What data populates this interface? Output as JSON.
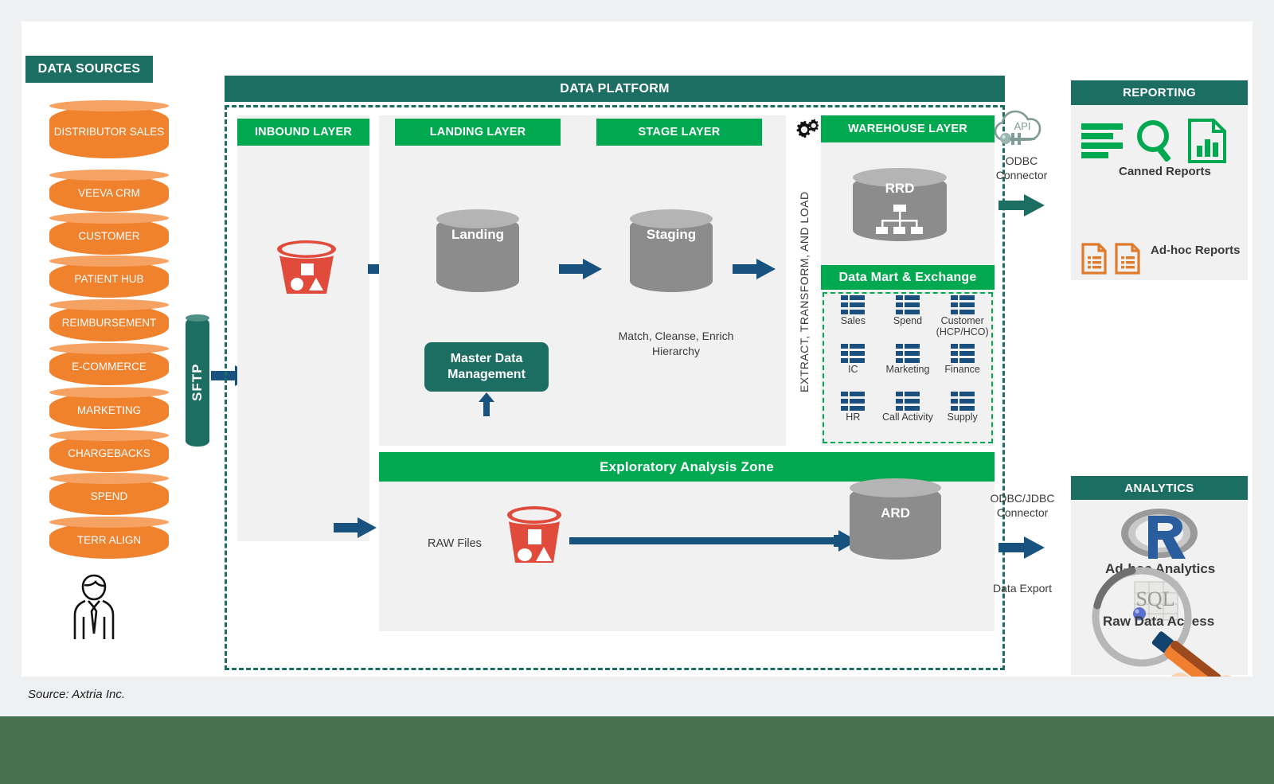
{
  "source_note": "Source: Axtria Inc.",
  "colors": {
    "teal": "#1d6e62",
    "green": "#00a84f",
    "orange": "#f0812d",
    "blue": "#18527f",
    "grey_cyl": "#8c8c8c",
    "red_bucket": "#e04b3c",
    "footer_green": "#477050",
    "panel_grey": "#f1f1f1"
  },
  "data_sources": {
    "header": "DATA SOURCES",
    "items": [
      "DISTRIBUTOR SALES",
      "VEEVA CRM",
      "CUSTOMER",
      "PATIENT HUB",
      "REIMBURSEMENT",
      "E-COMMERCE",
      "MARKETING",
      "CHARGEBACKS",
      "SPEND",
      "TERR ALIGN"
    ],
    "person_icon": "business-person-icon"
  },
  "transfer": {
    "sftp_label": "SFTP"
  },
  "platform": {
    "header": "DATA PLATFORM",
    "etl_label": "EXTRACT, TRANSFORM, AND LOAD",
    "gear_icon": "gears-icon",
    "layers": {
      "inbound": {
        "header": "INBOUND LAYER",
        "bucket_icon": "s3-bucket-icon"
      },
      "landing": {
        "header": "LANDING LAYER",
        "cylinder_label": "Landing",
        "mdm_label": "Master Data Management"
      },
      "stage": {
        "header": "STAGE LAYER",
        "cylinder_label": "Staging",
        "note_line1": "Match, Cleanse, Enrich",
        "note_line2": "Hierarchy"
      },
      "warehouse": {
        "header": "WAREHOUSE LAYER",
        "cylinder_label": "RRD",
        "hierarchy_icon": "hierarchy-icon",
        "data_mart_header": "Data Mart & Exchange",
        "marts": [
          {
            "label": "Sales",
            "icon": "grid-table-icon"
          },
          {
            "label": "Spend",
            "icon": "grid-table-icon"
          },
          {
            "label": "Customer (HCP/HCO)",
            "icon": "grid-table-icon"
          },
          {
            "label": "IC",
            "icon": "grid-table-icon"
          },
          {
            "label": "Marketing",
            "icon": "grid-table-icon"
          },
          {
            "label": "Finance",
            "icon": "grid-table-icon"
          },
          {
            "label": "HR",
            "icon": "grid-table-icon"
          },
          {
            "label": "Call Activity",
            "icon": "grid-table-icon"
          },
          {
            "label": "Supply",
            "icon": "grid-table-icon"
          }
        ]
      }
    },
    "exploratory": {
      "header": "Exploratory Analysis Zone",
      "raw_files_label": "RAW Files",
      "bucket_icon": "s3-bucket-icon",
      "cylinder_label": "ARD"
    }
  },
  "connectors": {
    "odbc": {
      "icon": "api-cloud-icon",
      "api_label": "API",
      "line1": "ODBC",
      "line2": "Connector"
    },
    "odbc_jdbc": {
      "line1": "ODBC/JDBC",
      "line2": "Connector"
    },
    "data_export": "Data Export"
  },
  "reporting": {
    "header": "REPORTING",
    "canned_label": "Canned Reports",
    "canned_icons": [
      "list-lines-icon",
      "magnifier-icon",
      "bar-chart-document-icon"
    ],
    "adhoc_label": "Ad-hoc Reports",
    "adhoc_icons": [
      "document-list-icon",
      "document-list-icon"
    ]
  },
  "analytics": {
    "header": "ANALYTICS",
    "adhoc_label": "Ad-hoc Analytics",
    "adhoc_icon": "r-logo-icon",
    "raw_label": "Raw Data Access",
    "raw_icon": "sql-magnifier-icon",
    "hand_icon": "hand-holding-magnifier-icon"
  }
}
